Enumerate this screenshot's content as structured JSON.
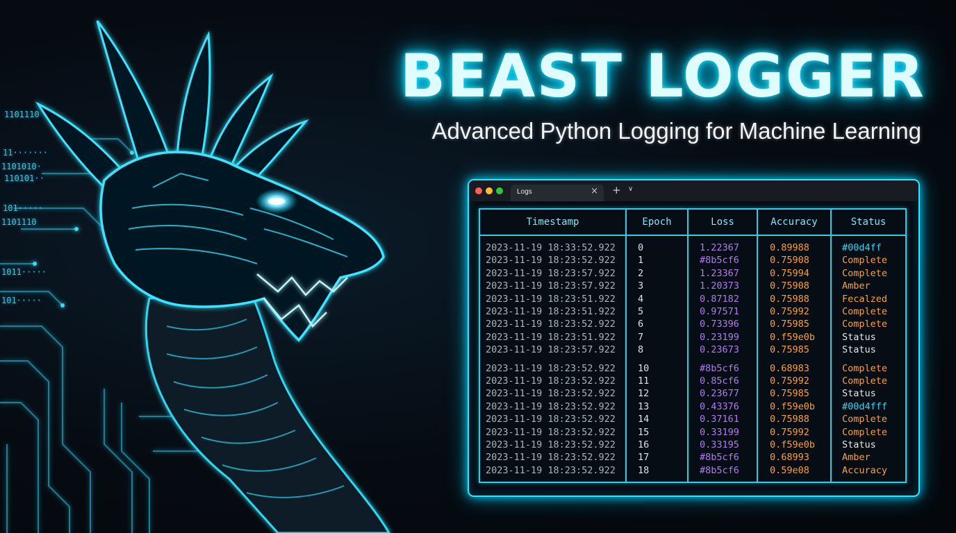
{
  "header": {
    "title": "BEAST LOGGER",
    "subtitle": "Advanced Python Logging for Machine Learning"
  },
  "decor": {
    "binary_lines": [
      "1101110",
      "1101110",
      "11·······",
      "11·······",
      "11·······",
      "11·······",
      "101·····",
      "1011·····",
      "101·····",
      "1101010·",
      "110101··",
      "101·····"
    ],
    "colors": {
      "neon_cyan": "#00d4ff",
      "purple": "#8b5cf6",
      "amber": "#f59e0b"
    }
  },
  "window": {
    "tab_label": "Logs",
    "tab_close": "×",
    "tab_add": "+",
    "tab_menu": "∨"
  },
  "table": {
    "headers": [
      "Timestamp",
      "Epoch",
      "Loss",
      "Accuracy",
      "Status"
    ],
    "rows": [
      {
        "ts": "2023-11-19 18:33:52.922",
        "epoch": "0",
        "loss": "1.22367",
        "acc": "0.89988",
        "status": "#00d4ff",
        "status_kind": "teal"
      },
      {
        "ts": "2023-11-19 18:23:52.922",
        "epoch": "1",
        "loss": "#8b5cf6",
        "acc": "0.75908",
        "status": "Complete",
        "status_kind": "complete"
      },
      {
        "ts": "2023-11-19 18:23:57.922",
        "epoch": "2",
        "loss": "1.23367",
        "acc": "0.75994",
        "status": "Complete",
        "status_kind": "complete"
      },
      {
        "ts": "2023-11-19 18:23:57.922",
        "epoch": "3",
        "loss": "1.20373",
        "acc": "0.75908",
        "status": "Amber",
        "status_kind": "amber"
      },
      {
        "ts": "2023-11-19 18:23:51.922",
        "epoch": "4",
        "loss": "0.87182",
        "acc": "0.75988",
        "status": "Fecalzed",
        "status_kind": "amber"
      },
      {
        "ts": "2023-11-19 18:23:51.922",
        "epoch": "5",
        "loss": "0.97571",
        "acc": "0.75992",
        "status": "Complete",
        "status_kind": "complete"
      },
      {
        "ts": "2023-11-19 18:23:52.922",
        "epoch": "6",
        "loss": "0.73396",
        "acc": "0.75985",
        "status": "Complete",
        "status_kind": "complete"
      },
      {
        "ts": "2023-11-19 18:23:51.922",
        "epoch": "7",
        "loss": "0.23199",
        "acc": "0.f59e0b",
        "status": "Status",
        "status_kind": "status"
      },
      {
        "ts": "2023-11-19 18:23:57.922",
        "epoch": "8",
        "loss": "0.23673",
        "acc": "0.75985",
        "status": "Status",
        "status_kind": "status"
      },
      {
        "ts": "2023-11-19 18:23:52.922",
        "epoch": "10",
        "loss": "#8b5cf6",
        "acc": "0.68983",
        "status": "Complete",
        "status_kind": "complete"
      },
      {
        "ts": "2023-11-19 18:23:52.922",
        "epoch": "11",
        "loss": "0.85cf6",
        "acc": "0.75992",
        "status": "Complete",
        "status_kind": "complete"
      },
      {
        "ts": "2023-11-19 18:23:52.922",
        "epoch": "12",
        "loss": "0.23677",
        "acc": "0.75985",
        "status": "Status",
        "status_kind": "status"
      },
      {
        "ts": "2023-11-19 18:23:52.922",
        "epoch": "13",
        "loss": "0.43376",
        "acc": "0.f59e0b",
        "status": "#00d4fff",
        "status_kind": "teal"
      },
      {
        "ts": "2023-11-19 18:23:52.922",
        "epoch": "14",
        "loss": "0.37161",
        "acc": "0.75988",
        "status": "Complete",
        "status_kind": "complete"
      },
      {
        "ts": "2023-11-19 18:23:52.922",
        "epoch": "15",
        "loss": "0.33199",
        "acc": "0.75992",
        "status": "Complete",
        "status_kind": "complete"
      },
      {
        "ts": "2023-11-19 18:23:52.922",
        "epoch": "16",
        "loss": "0.33195",
        "acc": "0.f59e0b",
        "status": "Status",
        "status_kind": "status"
      },
      {
        "ts": "2023-11-19 18:23:52.922",
        "epoch": "17",
        "loss": "#8b5cf6",
        "acc": "0.68993",
        "status": "Amber",
        "status_kind": "amber"
      },
      {
        "ts": "2023-11-19 18:23:52.922",
        "epoch": "18",
        "loss": "#8b5cf6",
        "acc": "0.59e08",
        "status": "Accuracy",
        "status_kind": "amber"
      }
    ]
  }
}
